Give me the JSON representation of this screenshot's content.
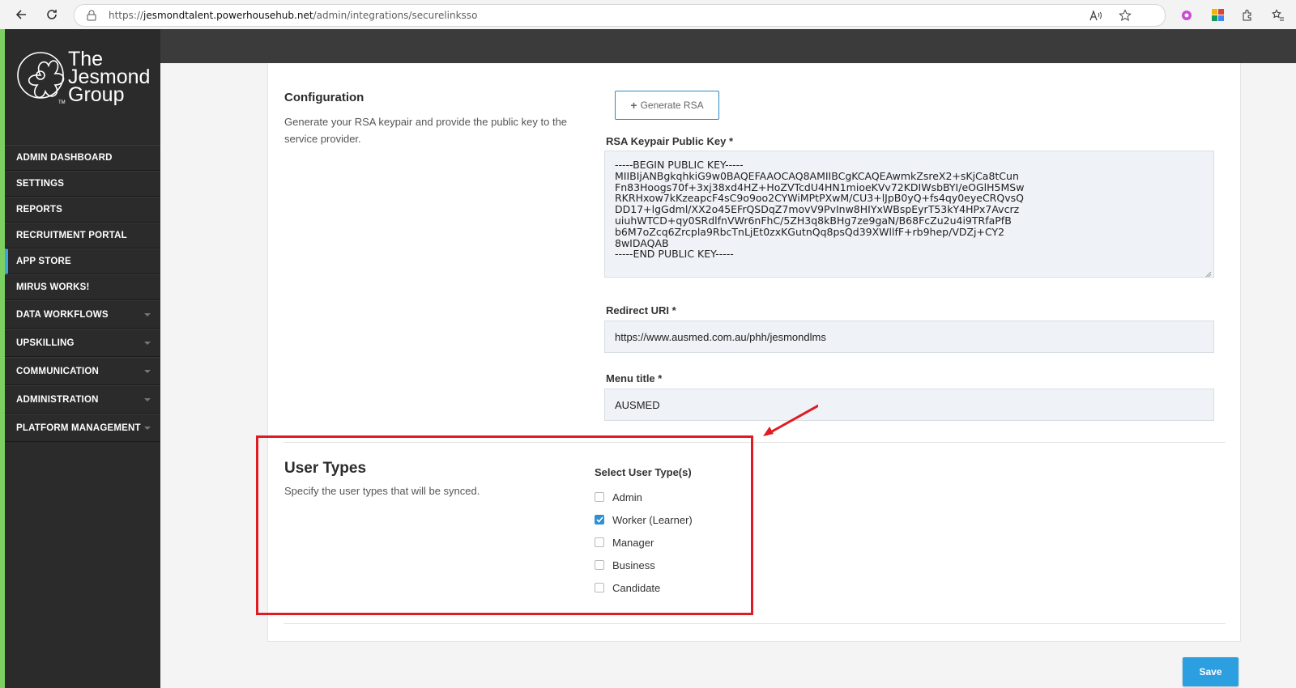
{
  "browser": {
    "url_prefix": "https://",
    "url_host": "jesmondtalent.powerhousehub.net",
    "url_path": "/admin/integrations/securelinksso"
  },
  "sidebar": {
    "brand_line1": "The",
    "brand_line2": "Jesmond",
    "brand_line3": "Group",
    "items": [
      {
        "label": "ADMIN DASHBOARD"
      },
      {
        "label": "SETTINGS"
      },
      {
        "label": "REPORTS"
      },
      {
        "label": "RECRUITMENT PORTAL"
      },
      {
        "label": "APP STORE"
      },
      {
        "label": "MIRUS WORKS!"
      },
      {
        "label": "DATA WORKFLOWS"
      },
      {
        "label": "UPSKILLING"
      },
      {
        "label": "COMMUNICATION"
      },
      {
        "label": "ADMINISTRATION"
      },
      {
        "label": "PLATFORM MANAGEMENT"
      }
    ]
  },
  "configuration": {
    "title": "Configuration",
    "description_line1": "Generate your RSA keypair and provide the public key to the",
    "description_line2": "service provider.",
    "generate_button": "Generate RSA",
    "public_key_label": "RSA Keypair Public Key *",
    "public_key_value": "-----BEGIN PUBLIC KEY-----\nMIIBIjANBgkqhkiG9w0BAQEFAAOCAQ8AMIIBCgKCAQEAwmkZsreX2+sKjCa8tCun\nFn83Hoogs70f+3xj38xd4HZ+HoZVTcdU4HN1mioeKVv72KDIWsbBYI/eOGlH5MSw\nRKRHxow7kKzeapcF4sC9o9oo2CYWiMPtPXwM/CU3+lJpB0yQ+fs4qy0eyeCRQvsQ\nDD17+lgGdml/XX2o45EFrQSDqZ7movV9PvInw8HIYxWBspEyrT53kY4HPx7Avcrz\nuiuhWTCD+qy0SRdlfnVWr6nFhC/5ZH3q8kBHg7ze9gaN/B68FcZu2u4i9TRfaPfB\nb6M7oZcq6Zrcpla9RbcTnLjEt0zxKGutnQq8psQd39XWllfF+rb9hep/VDZj+CY2\n8wIDAQAB\n-----END PUBLIC KEY-----",
    "redirect_label": "Redirect URI *",
    "redirect_value": "https://www.ausmed.com.au/phh/jesmondlms",
    "menu_title_label": "Menu title *",
    "menu_title_value": "AUSMED"
  },
  "user_types": {
    "title": "User Types",
    "description": "Specify the user types that will be synced.",
    "select_label": "Select User Type(s)",
    "options": [
      {
        "label": "Admin",
        "checked": false
      },
      {
        "label": "Worker (Learner)",
        "checked": true
      },
      {
        "label": "Manager",
        "checked": false
      },
      {
        "label": "Business",
        "checked": false
      },
      {
        "label": "Candidate",
        "checked": false
      }
    ]
  },
  "save_button": "Save",
  "colors": {
    "accent": "#2c9fe0",
    "sidebar_bg": "#2b2b2b",
    "annotation_red": "#e11b22",
    "active_indicator": "#3ea4df"
  }
}
